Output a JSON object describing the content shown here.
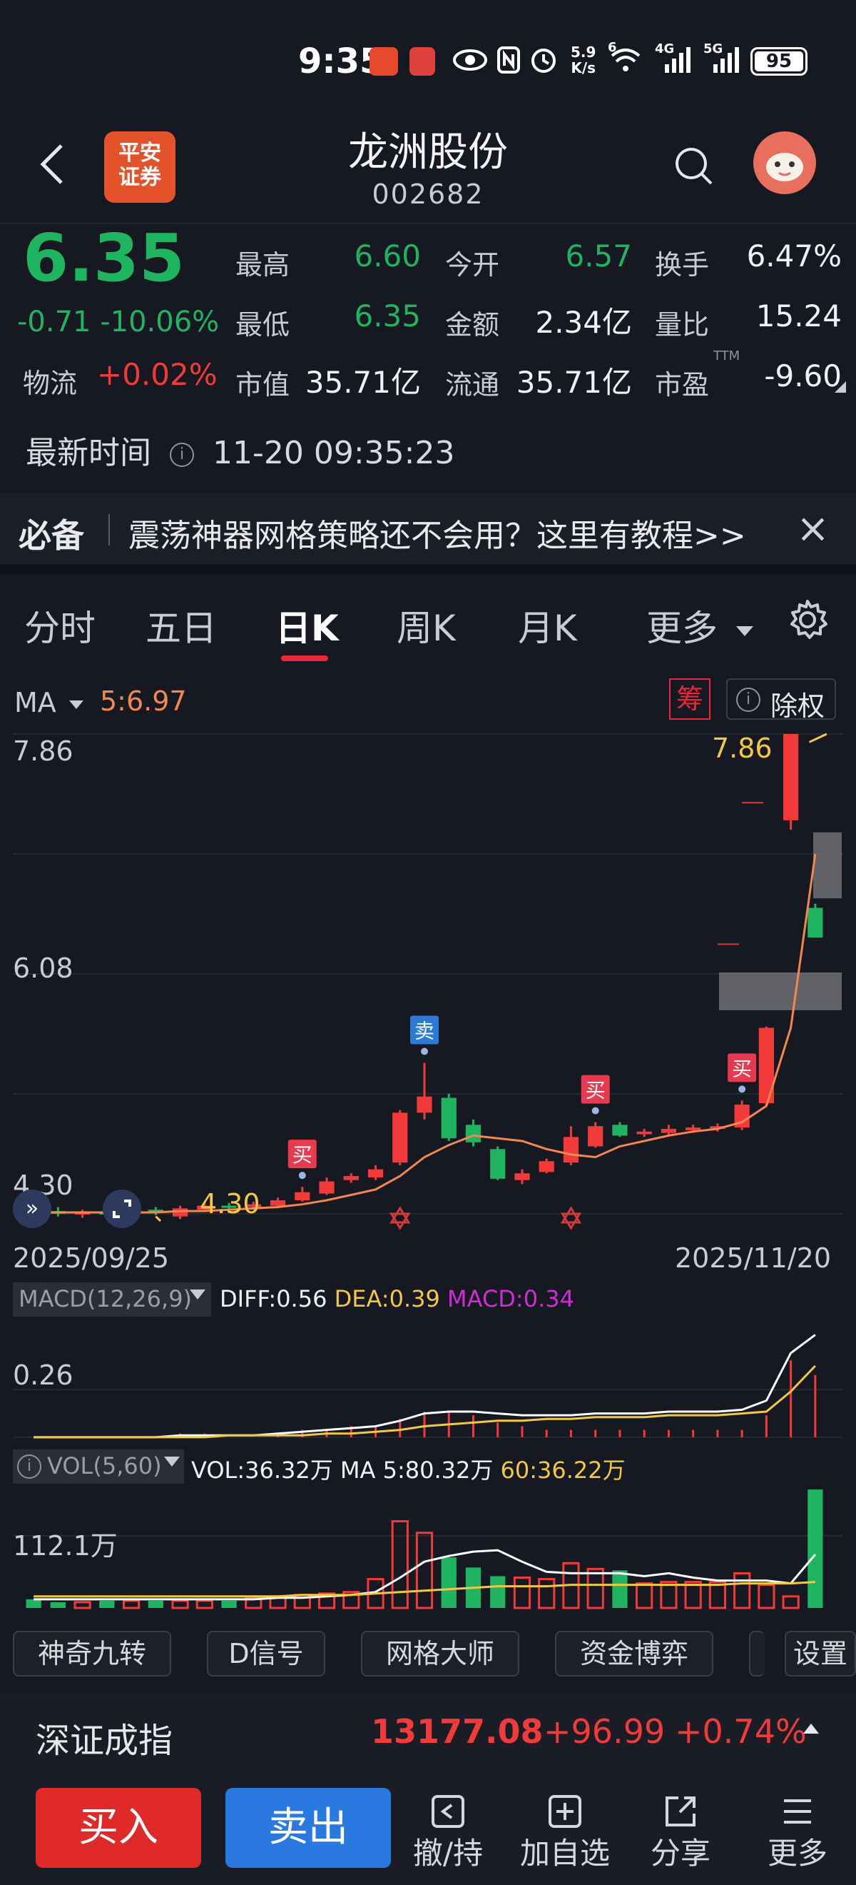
{
  "status_bar": {
    "time": "9:35",
    "net_speed_top": "5.9",
    "net_speed_unit": "K/s",
    "net_6": "6",
    "net_4g": "4G",
    "net_5g": "5G",
    "battery": "95"
  },
  "header": {
    "logo_line1": "平安",
    "logo_line2": "证券",
    "name": "龙洲股份",
    "code": "002682"
  },
  "quote": {
    "price": "6.35",
    "change": "-0.71",
    "change_pct": "-10.06%",
    "sector_label": "物流",
    "sector_pct": "+0.02%",
    "high_label": "最高",
    "high": "6.60",
    "low_label": "最低",
    "low": "6.35",
    "open_label": "今开",
    "open": "6.57",
    "amount_label": "金额",
    "amount": "2.34亿",
    "turnover_label": "换手",
    "turnover": "6.47%",
    "vol_ratio_label": "量比",
    "vol_ratio": "15.24",
    "mcap_label": "市值",
    "mcap": "35.71亿",
    "float_label": "流通",
    "float_cap": "35.71亿",
    "pe_label": "市盈",
    "pe_sup": "TTM",
    "pe": "-9.60",
    "time_label": "最新时间",
    "time": "11-20 09:35:23"
  },
  "banner": {
    "tag": "必备",
    "text": "震荡神器网格策略还不会用？这里有教程>>"
  },
  "tabs": [
    "分时",
    "五日",
    "日K",
    "周K",
    "月K",
    "更多"
  ],
  "chart_toolbar": {
    "ma_label": "MA",
    "ma_value": "5:6.97",
    "chip_label": "筹",
    "adjust_label": "除权"
  },
  "chart_data": {
    "type": "candlestick",
    "y_max_label": "7.86",
    "y_mid_label": "6.08",
    "y_min_label": "4.30",
    "high_marker": "7.86",
    "low_marker": "4.30",
    "start_date": "2025/09/25",
    "end_date": "2025/11/20",
    "buy_label": "买",
    "sell_label": "卖",
    "ylim": [
      4.13,
      7.86
    ],
    "candles": [
      {
        "o": 4.33,
        "c": 4.31,
        "h": 4.36,
        "l": 4.26
      },
      {
        "o": 4.32,
        "c": 4.3,
        "h": 4.35,
        "l": 4.28
      },
      {
        "o": 4.3,
        "c": 4.31,
        "h": 4.33,
        "l": 4.27
      },
      {
        "o": 4.31,
        "c": 4.3,
        "h": 4.34,
        "l": 4.28
      },
      {
        "o": 4.3,
        "c": 4.33,
        "h": 4.35,
        "l": 4.29
      },
      {
        "o": 4.33,
        "c": 4.31,
        "h": 4.35,
        "l": 4.29
      },
      {
        "o": 4.28,
        "c": 4.34,
        "h": 4.36,
        "l": 4.26
      },
      {
        "o": 4.33,
        "c": 4.36,
        "h": 4.38,
        "l": 4.32
      },
      {
        "o": 4.36,
        "c": 4.35,
        "h": 4.38,
        "l": 4.33
      },
      {
        "o": 4.35,
        "c": 4.37,
        "h": 4.39,
        "l": 4.33
      },
      {
        "o": 4.36,
        "c": 4.4,
        "h": 4.42,
        "l": 4.34
      },
      {
        "o": 4.4,
        "c": 4.46,
        "h": 4.5,
        "l": 4.39
      },
      {
        "o": 4.45,
        "c": 4.54,
        "h": 4.57,
        "l": 4.44
      },
      {
        "o": 4.55,
        "c": 4.58,
        "h": 4.6,
        "l": 4.53
      },
      {
        "o": 4.57,
        "c": 4.63,
        "h": 4.66,
        "l": 4.55
      },
      {
        "o": 4.68,
        "c": 5.05,
        "h": 5.07,
        "l": 4.66
      },
      {
        "o": 5.05,
        "c": 5.17,
        "h": 5.42,
        "l": 5.0
      },
      {
        "o": 5.16,
        "c": 4.86,
        "h": 5.19,
        "l": 4.84
      },
      {
        "o": 4.96,
        "c": 4.83,
        "h": 5.0,
        "l": 4.8
      },
      {
        "o": 4.78,
        "c": 4.56,
        "h": 4.8,
        "l": 4.55
      },
      {
        "o": 4.55,
        "c": 4.6,
        "h": 4.63,
        "l": 4.52
      },
      {
        "o": 4.61,
        "c": 4.69,
        "h": 4.71,
        "l": 4.6
      },
      {
        "o": 4.68,
        "c": 4.87,
        "h": 4.95,
        "l": 4.66
      },
      {
        "o": 4.8,
        "c": 4.95,
        "h": 4.98,
        "l": 4.79
      },
      {
        "o": 4.96,
        "c": 4.88,
        "h": 4.98,
        "l": 4.87
      },
      {
        "o": 4.89,
        "c": 4.91,
        "h": 4.93,
        "l": 4.87
      },
      {
        "o": 4.9,
        "c": 4.93,
        "h": 4.96,
        "l": 4.88
      },
      {
        "o": 4.92,
        "c": 4.94,
        "h": 4.96,
        "l": 4.9
      },
      {
        "o": 4.93,
        "c": 4.95,
        "h": 4.97,
        "l": 4.91
      },
      {
        "o": 4.94,
        "c": 5.11,
        "h": 5.14,
        "l": 4.92
      },
      {
        "o": 5.12,
        "c": 5.68,
        "h": 5.69,
        "l": 5.1
      },
      {
        "o": 7.22,
        "c": 7.86,
        "h": 7.86,
        "l": 7.15
      },
      {
        "o": 6.57,
        "c": 6.35,
        "h": 6.6,
        "l": 6.35
      }
    ],
    "ma5": [
      4.31,
      4.31,
      4.31,
      4.31,
      4.31,
      4.31,
      4.32,
      4.32,
      4.33,
      4.34,
      4.35,
      4.37,
      4.4,
      4.44,
      4.48,
      4.58,
      4.72,
      4.81,
      4.88,
      4.86,
      4.84,
      4.78,
      4.74,
      4.72,
      4.8,
      4.84,
      4.88,
      4.91,
      4.93,
      4.98,
      5.1,
      5.68,
      6.97
    ]
  },
  "macd": {
    "label": "MACD(12,26,9)",
    "diff": "DIFF:0.56",
    "dea": "DEA:0.39",
    "macd": "MACD:0.34",
    "axis_label": "0.26",
    "diff_series": [
      0.0,
      0.0,
      0.0,
      0.0,
      0.0,
      0.0,
      0.01,
      0.01,
      0.01,
      0.01,
      0.02,
      0.03,
      0.04,
      0.05,
      0.06,
      0.09,
      0.13,
      0.14,
      0.14,
      0.13,
      0.12,
      0.12,
      0.12,
      0.13,
      0.13,
      0.13,
      0.14,
      0.14,
      0.14,
      0.15,
      0.2,
      0.46,
      0.56
    ],
    "dea_series": [
      0.0,
      0.0,
      0.0,
      0.0,
      0.0,
      0.0,
      0.0,
      0.0,
      0.01,
      0.01,
      0.01,
      0.01,
      0.02,
      0.02,
      0.03,
      0.04,
      0.06,
      0.07,
      0.08,
      0.09,
      0.09,
      0.1,
      0.1,
      0.11,
      0.11,
      0.11,
      0.12,
      0.12,
      0.12,
      0.13,
      0.14,
      0.25,
      0.39
    ],
    "ylim": [
      -0.02,
      0.62
    ]
  },
  "vol": {
    "label": "VOL(5,60)",
    "vol": "VOL:36.32万",
    "ma5": "MA 5:80.32万",
    "ma60": "60:36.22万",
    "axis_label": "112.1万",
    "values": [
      6,
      4,
      4,
      5,
      5,
      5,
      5,
      5,
      5,
      7,
      8,
      9,
      10,
      11,
      20,
      60,
      52,
      35,
      28,
      22,
      21,
      20,
      31,
      27,
      26,
      17,
      18,
      18,
      18,
      24,
      16,
      8,
      82
    ],
    "ma5_series": [
      6,
      6,
      6,
      6,
      6,
      6,
      6,
      6,
      6,
      6,
      7,
      7,
      8,
      9,
      11,
      21,
      32,
      36,
      39,
      40,
      32,
      25,
      24,
      24,
      24,
      22,
      24,
      21,
      19,
      19,
      19,
      17,
      37
    ],
    "ma60_series": [
      8,
      8,
      8,
      8,
      8,
      8,
      8,
      8,
      8,
      8,
      8,
      9,
      9,
      9,
      10,
      11,
      12,
      13,
      14,
      15,
      15,
      15,
      16,
      16,
      16,
      16,
      16,
      16,
      16,
      17,
      17,
      17,
      18
    ],
    "ylim": [
      0,
      85
    ]
  },
  "indicators": [
    "神奇九转",
    "D信号",
    "网格大师",
    "资金博弈"
  ],
  "settings_label": "设置",
  "index_bar": {
    "name": "深证成指",
    "value": "13177.08",
    "change": "+96.99",
    "pct": "+0.74%"
  },
  "bottom_bar": {
    "buy": "买入",
    "sell": "卖出",
    "cancel": "撤/持",
    "add": "加自选",
    "share": "分享",
    "more": "更多"
  },
  "colors": {
    "up": "#f23a3a",
    "down": "#1fb45f",
    "ma_line": "#f3884d",
    "diff_line": "#ffffff",
    "dea_line": "#f2c744",
    "bg": "#161922"
  }
}
